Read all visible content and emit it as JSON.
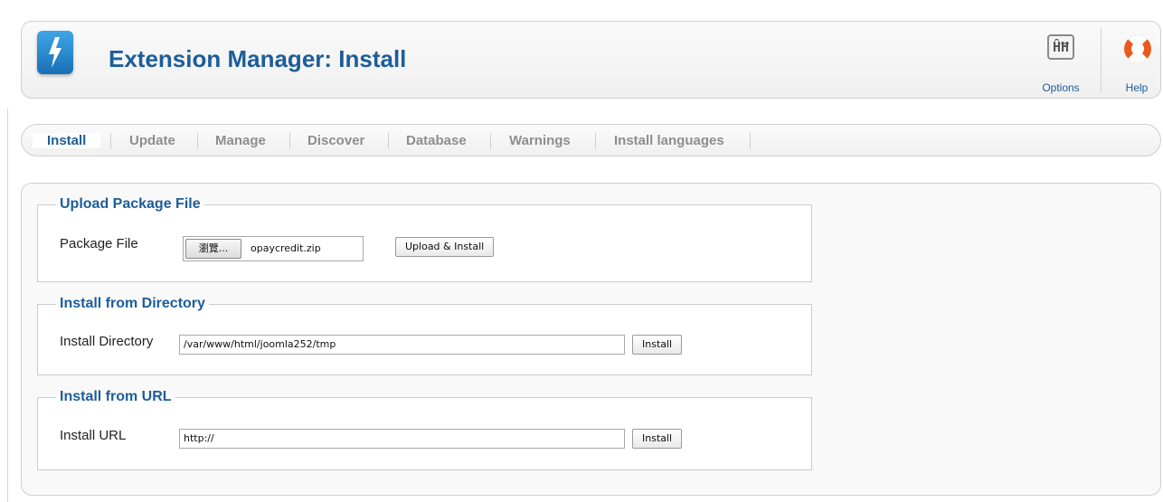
{
  "header": {
    "title": "Extension Manager: Install",
    "app_icon": "extension-manager-bolt-icon",
    "toolbar": {
      "options_label": "Options",
      "options_icon": "options-toggle-icon",
      "help_label": "Help",
      "help_icon": "lifebuoy-icon"
    }
  },
  "tabs": [
    {
      "label": "Install",
      "active": true
    },
    {
      "label": "Update",
      "active": false
    },
    {
      "label": "Manage",
      "active": false
    },
    {
      "label": "Discover",
      "active": false
    },
    {
      "label": "Database",
      "active": false
    },
    {
      "label": "Warnings",
      "active": false
    },
    {
      "label": "Install languages",
      "active": false
    }
  ],
  "upload": {
    "legend": "Upload Package File",
    "label": "Package File",
    "browse_label": "瀏覽...",
    "file_name": "opaycredit.zip",
    "button_label": "Upload & Install"
  },
  "directory": {
    "legend": "Install from Directory",
    "label": "Install Directory",
    "value": "/var/www/html/joomla252/tmp",
    "button_label": "Install"
  },
  "url": {
    "legend": "Install from URL",
    "label": "Install URL",
    "value": "http://",
    "button_label": "Install"
  },
  "colors": {
    "title_blue": "#1d5d99",
    "inactive_tab": "#8e8e8e"
  }
}
